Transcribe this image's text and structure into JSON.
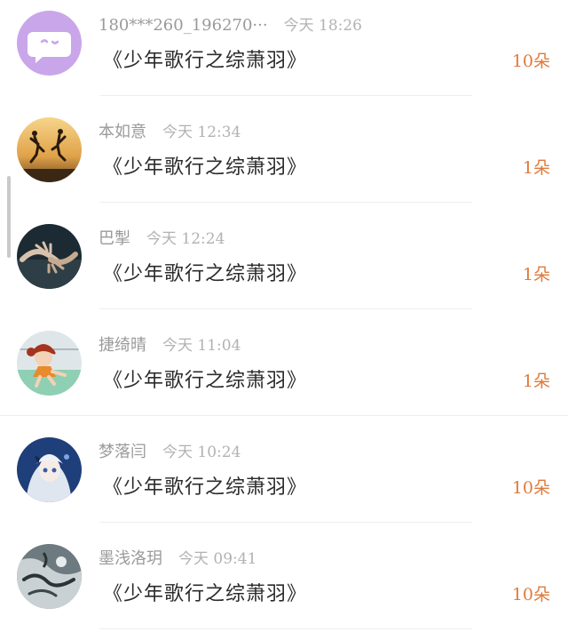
{
  "colors": {
    "accent": "#e07a3a",
    "meta": "#9a9a9a"
  },
  "items": [
    {
      "user": "180***260_196270···",
      "time": "今天 18:26",
      "title": "《少年歌行之综萧羽》",
      "count": "10朵",
      "avatar_icon": "purple-chat-bubble-avatar-icon"
    },
    {
      "user": "本如意",
      "time": "今天 12:34",
      "title": "《少年歌行之综萧羽》",
      "count": "1朵",
      "avatar_icon": "sunset-jump-avatar-icon"
    },
    {
      "user": "巴掣",
      "time": "今天 12:24",
      "title": "《少年歌行之综萧羽》",
      "count": "1朵",
      "avatar_icon": "hands-avatar-icon"
    },
    {
      "user": "捷绮晴",
      "time": "今天 11:04",
      "title": "《少年歌行之综萧羽》",
      "count": "1朵",
      "avatar_icon": "cartoon-girl-avatar-icon"
    },
    {
      "user": "梦落闫",
      "time": "今天 10:24",
      "title": "《少年歌行之综萧羽》",
      "count": "10朵",
      "avatar_icon": "anime-girl-avatar-icon"
    },
    {
      "user": "墨浅洛玥",
      "time": "今天 09:41",
      "title": "《少年歌行之综萧羽》",
      "count": "10朵",
      "avatar_icon": "ink-wash-avatar-icon"
    }
  ]
}
